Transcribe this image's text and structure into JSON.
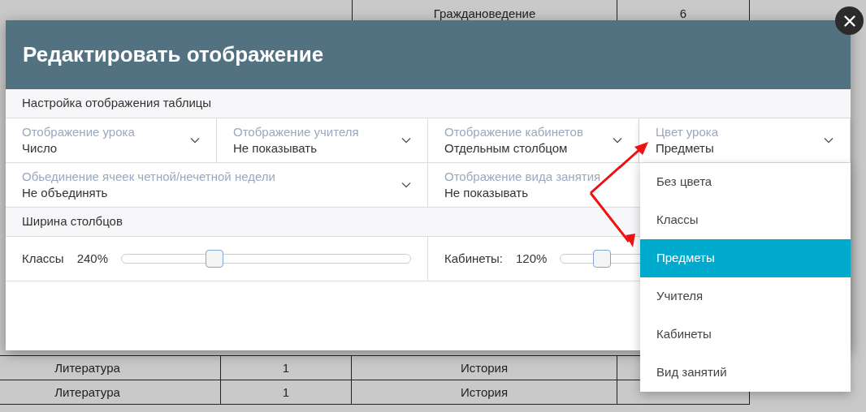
{
  "background_table": {
    "top_row": [
      "Граждановедение",
      "6"
    ],
    "rows": [
      [
        "Литература",
        "1",
        "История"
      ],
      [
        "Литература",
        "1",
        "История"
      ]
    ]
  },
  "dialog": {
    "title": "Редактировать отображение",
    "sections": [
      {
        "title": "Настройка отображения таблицы",
        "kind": "selects",
        "fields": [
          {
            "kind": "narrow",
            "label": "Отображение урока",
            "value": "Число"
          },
          {
            "kind": "narrow",
            "label": "Отображение учителя",
            "value": "Не показывать"
          },
          {
            "kind": "narrow",
            "label": "Отображение кабинетов",
            "value": "Отдельным столбцом"
          },
          {
            "kind": "narrow",
            "label": "Цвет урока",
            "value": "Предметы",
            "expanded": true
          },
          {
            "kind": "wide",
            "label": "Обьединение ячеек четной/нечетной недели",
            "value": "Не объединять"
          },
          {
            "kind": "wide_covered",
            "label": "Отображение вида занятия",
            "value": "Не показывать"
          }
        ]
      },
      {
        "title": "Ширина столбцов",
        "kind": "sliders",
        "sliders": [
          {
            "label": "Классы",
            "reading": "240%",
            "level": 0.31
          },
          {
            "label": "Кабинеты:",
            "reading": "120%",
            "level": 0.13
          }
        ]
      }
    ]
  },
  "dropdown": {
    "options": [
      {
        "label": "Без цвета",
        "selected": false
      },
      {
        "label": "Классы",
        "selected": false
      },
      {
        "label": "Предметы",
        "selected": true
      },
      {
        "label": "Учителя",
        "selected": false
      },
      {
        "label": "Кабинеты",
        "selected": false
      },
      {
        "label": "Вид занятий",
        "selected": false
      }
    ]
  }
}
